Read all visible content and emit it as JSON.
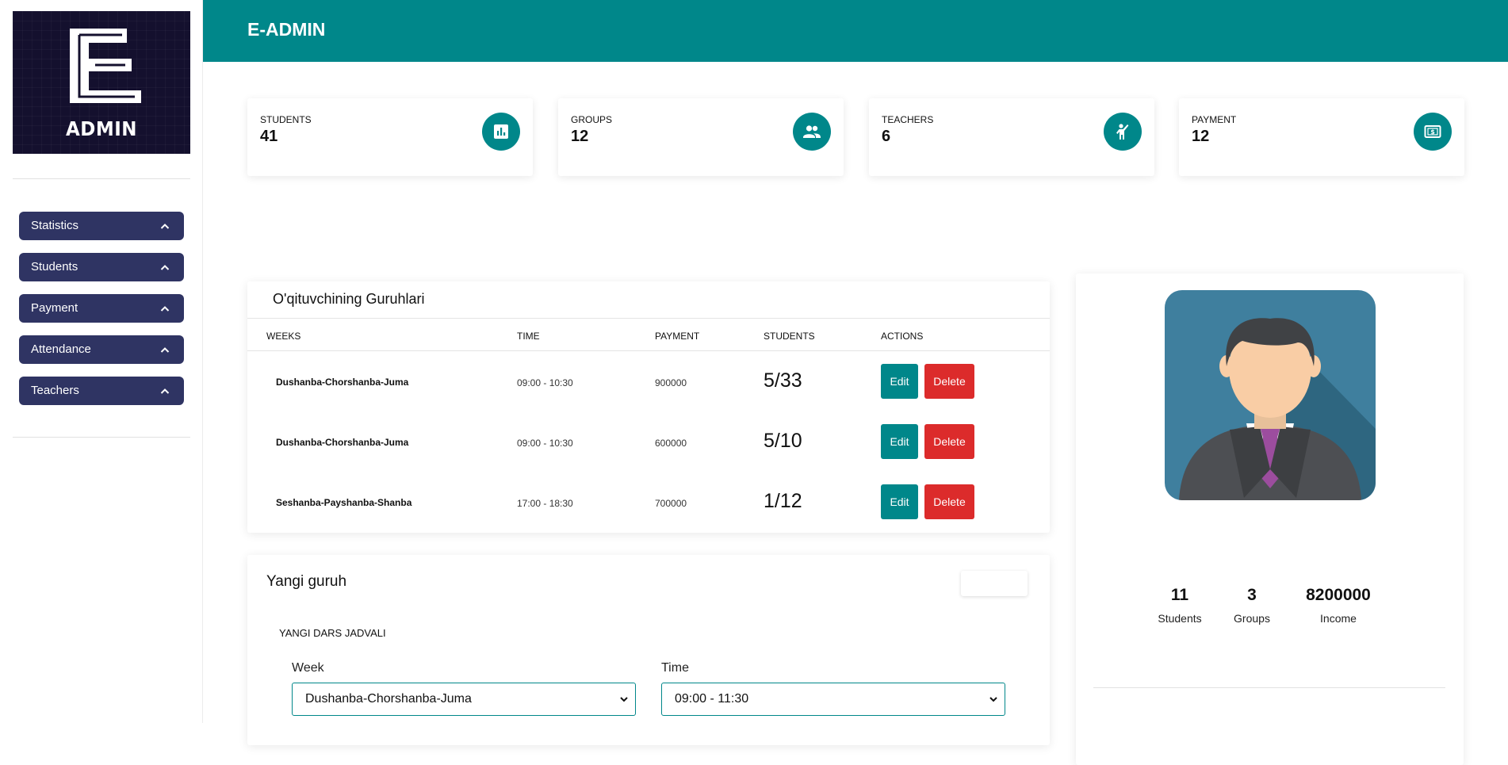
{
  "app": {
    "brand": "E-ADMIN",
    "logo_text": "ADMIN"
  },
  "sidebar": {
    "items": [
      {
        "label": "Statistics",
        "icon": "chevron-up-icon"
      },
      {
        "label": "Students",
        "icon": "chevron-up-icon"
      },
      {
        "label": "Payment",
        "icon": "chevron-up-icon"
      },
      {
        "label": "Attendance",
        "icon": "chevron-up-icon"
      },
      {
        "label": "Teachers",
        "icon": "chevron-up-icon"
      }
    ]
  },
  "summary_cards": [
    {
      "label": "STUDENTS",
      "value": "41",
      "icon": "bar-chart-icon"
    },
    {
      "label": "GROUPS",
      "value": "12",
      "icon": "people-icon"
    },
    {
      "label": "TEACHERS",
      "value": "6",
      "icon": "person-raised-hand-icon"
    },
    {
      "label": "PAYMENT",
      "value": "12",
      "icon": "money-icon"
    }
  ],
  "groups_table": {
    "title": "O'qituvchining Guruhlari",
    "headers": [
      "WEEKS",
      "TIME",
      "PAYMENT",
      "STUDENTS",
      "ACTIONS"
    ],
    "rows": [
      {
        "weeks": "Dushanba-Chorshanba-Juma",
        "time": "09:00 - 10:30",
        "payment": "900000",
        "students": "5/33",
        "edit": "Edit",
        "delete": "Delete"
      },
      {
        "weeks": "Dushanba-Chorshanba-Juma",
        "time": "09:00 - 10:30",
        "payment": "600000",
        "students": "5/10",
        "edit": "Edit",
        "delete": "Delete"
      },
      {
        "weeks": "Seshanba-Payshanba-Shanba",
        "time": "17:00 - 18:30",
        "payment": "700000",
        "students": "1/12",
        "edit": "Edit",
        "delete": "Delete"
      }
    ]
  },
  "new_group_form": {
    "title": "Yangi guruh",
    "subtitle": "YANGI DARS JADVALI",
    "week_label": "Week",
    "week_value": "Dushanba-Chorshanba-Juma",
    "time_label": "Time",
    "time_value": "09:00 - 11:30"
  },
  "profile": {
    "avatar_icon": "user-avatar-icon",
    "stats": [
      {
        "value": "11",
        "caption": "Students"
      },
      {
        "value": "3",
        "caption": "Groups"
      },
      {
        "value": "8200000",
        "caption": "Income"
      }
    ]
  },
  "colors": {
    "teal": "#00878a",
    "navy": "#2f3463",
    "logo_bg": "#14102e",
    "danger": "#dc2b2b"
  }
}
